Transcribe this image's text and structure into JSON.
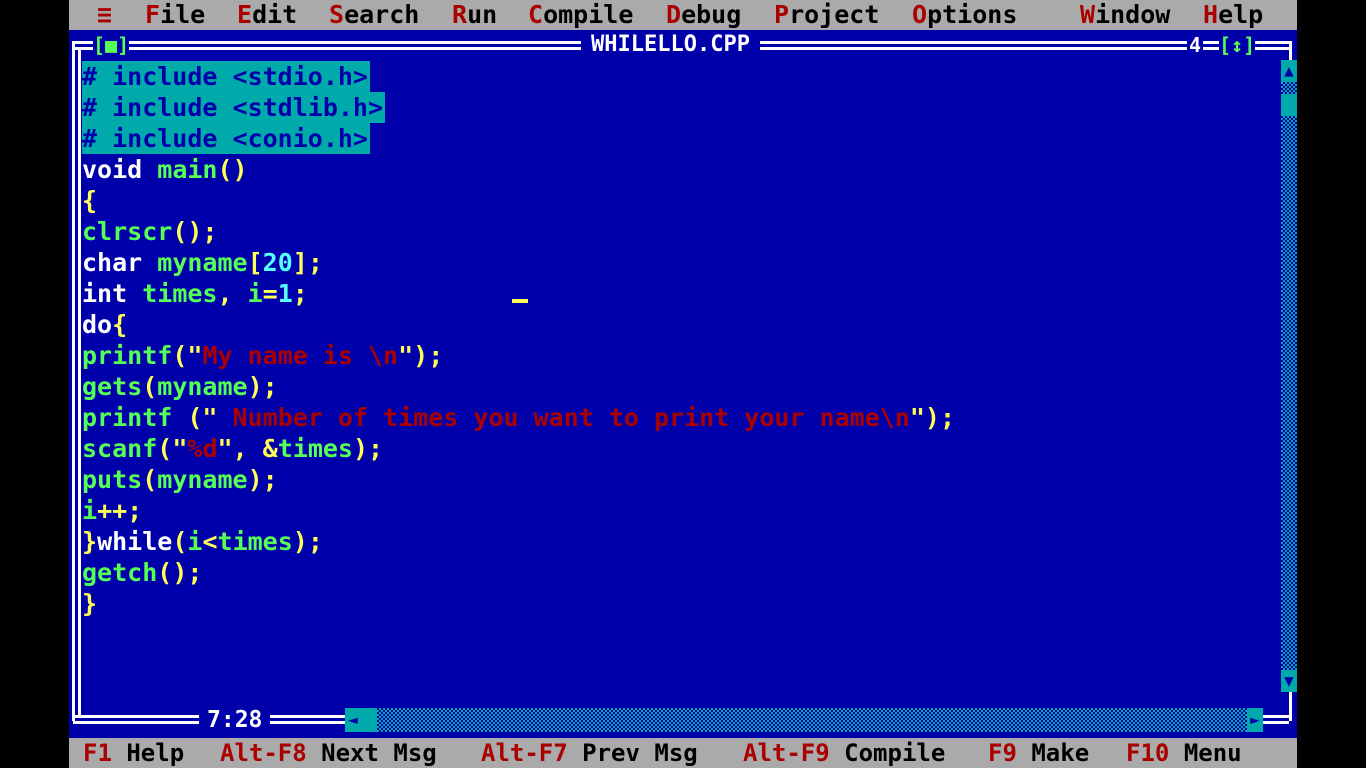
{
  "menubar": {
    "system_icon": "≡",
    "items": [
      {
        "hot": "F",
        "rest": "ile"
      },
      {
        "hot": "E",
        "rest": "dit"
      },
      {
        "hot": "S",
        "rest": "earch"
      },
      {
        "hot": "R",
        "rest": "un"
      },
      {
        "hot": "C",
        "rest": "ompile"
      },
      {
        "hot": "D",
        "rest": "ebug"
      },
      {
        "hot": "P",
        "rest": "roject"
      },
      {
        "hot": "O",
        "rest": "ptions"
      },
      {
        "hot": "W",
        "rest": "indow"
      },
      {
        "hot": "H",
        "rest": "elp"
      }
    ]
  },
  "window": {
    "title": "WHILELLO.CPP",
    "close_button": "[■]",
    "window_number": "4",
    "zoom_button": "[↕]"
  },
  "code": {
    "lines": [
      "# include <stdio.h>",
      "# include <stdlib.h>",
      "# include <conio.h>",
      "void main()",
      "{",
      "clrscr();",
      "char myname[20];",
      "int times, i=1;",
      "do{",
      "printf(\"My name is \\n\");",
      "gets(myname);",
      "printf (\" Number of times you want to print your name\\n\");",
      "scanf(\"%d\", &times);",
      "puts(myname);",
      "i++;",
      "}while(i<times);",
      "getch();",
      "}"
    ]
  },
  "scrollbar": {
    "up_arrow": "▲",
    "down_arrow": "▼",
    "left_arrow": "◄",
    "right_arrow": "►"
  },
  "position": "7:28",
  "statusbar": {
    "items": [
      {
        "key": "F1",
        "label": "Help"
      },
      {
        "key": "Alt-F8",
        "label": "Next Msg"
      },
      {
        "key": "Alt-F7",
        "label": "Prev Msg"
      },
      {
        "key": "Alt-F9",
        "label": "Compile"
      },
      {
        "key": "F9",
        "label": "Make"
      },
      {
        "key": "F10",
        "label": "Menu"
      }
    ]
  },
  "colors": {
    "background": "#0000aa",
    "menubar": "#aaaaaa",
    "hotkey": "#aa0000",
    "selection": "#00aaaa",
    "identifier": "#55ff55",
    "punctuation": "#ffff55",
    "string": "#aa0000",
    "keyword": "#ffffff"
  }
}
